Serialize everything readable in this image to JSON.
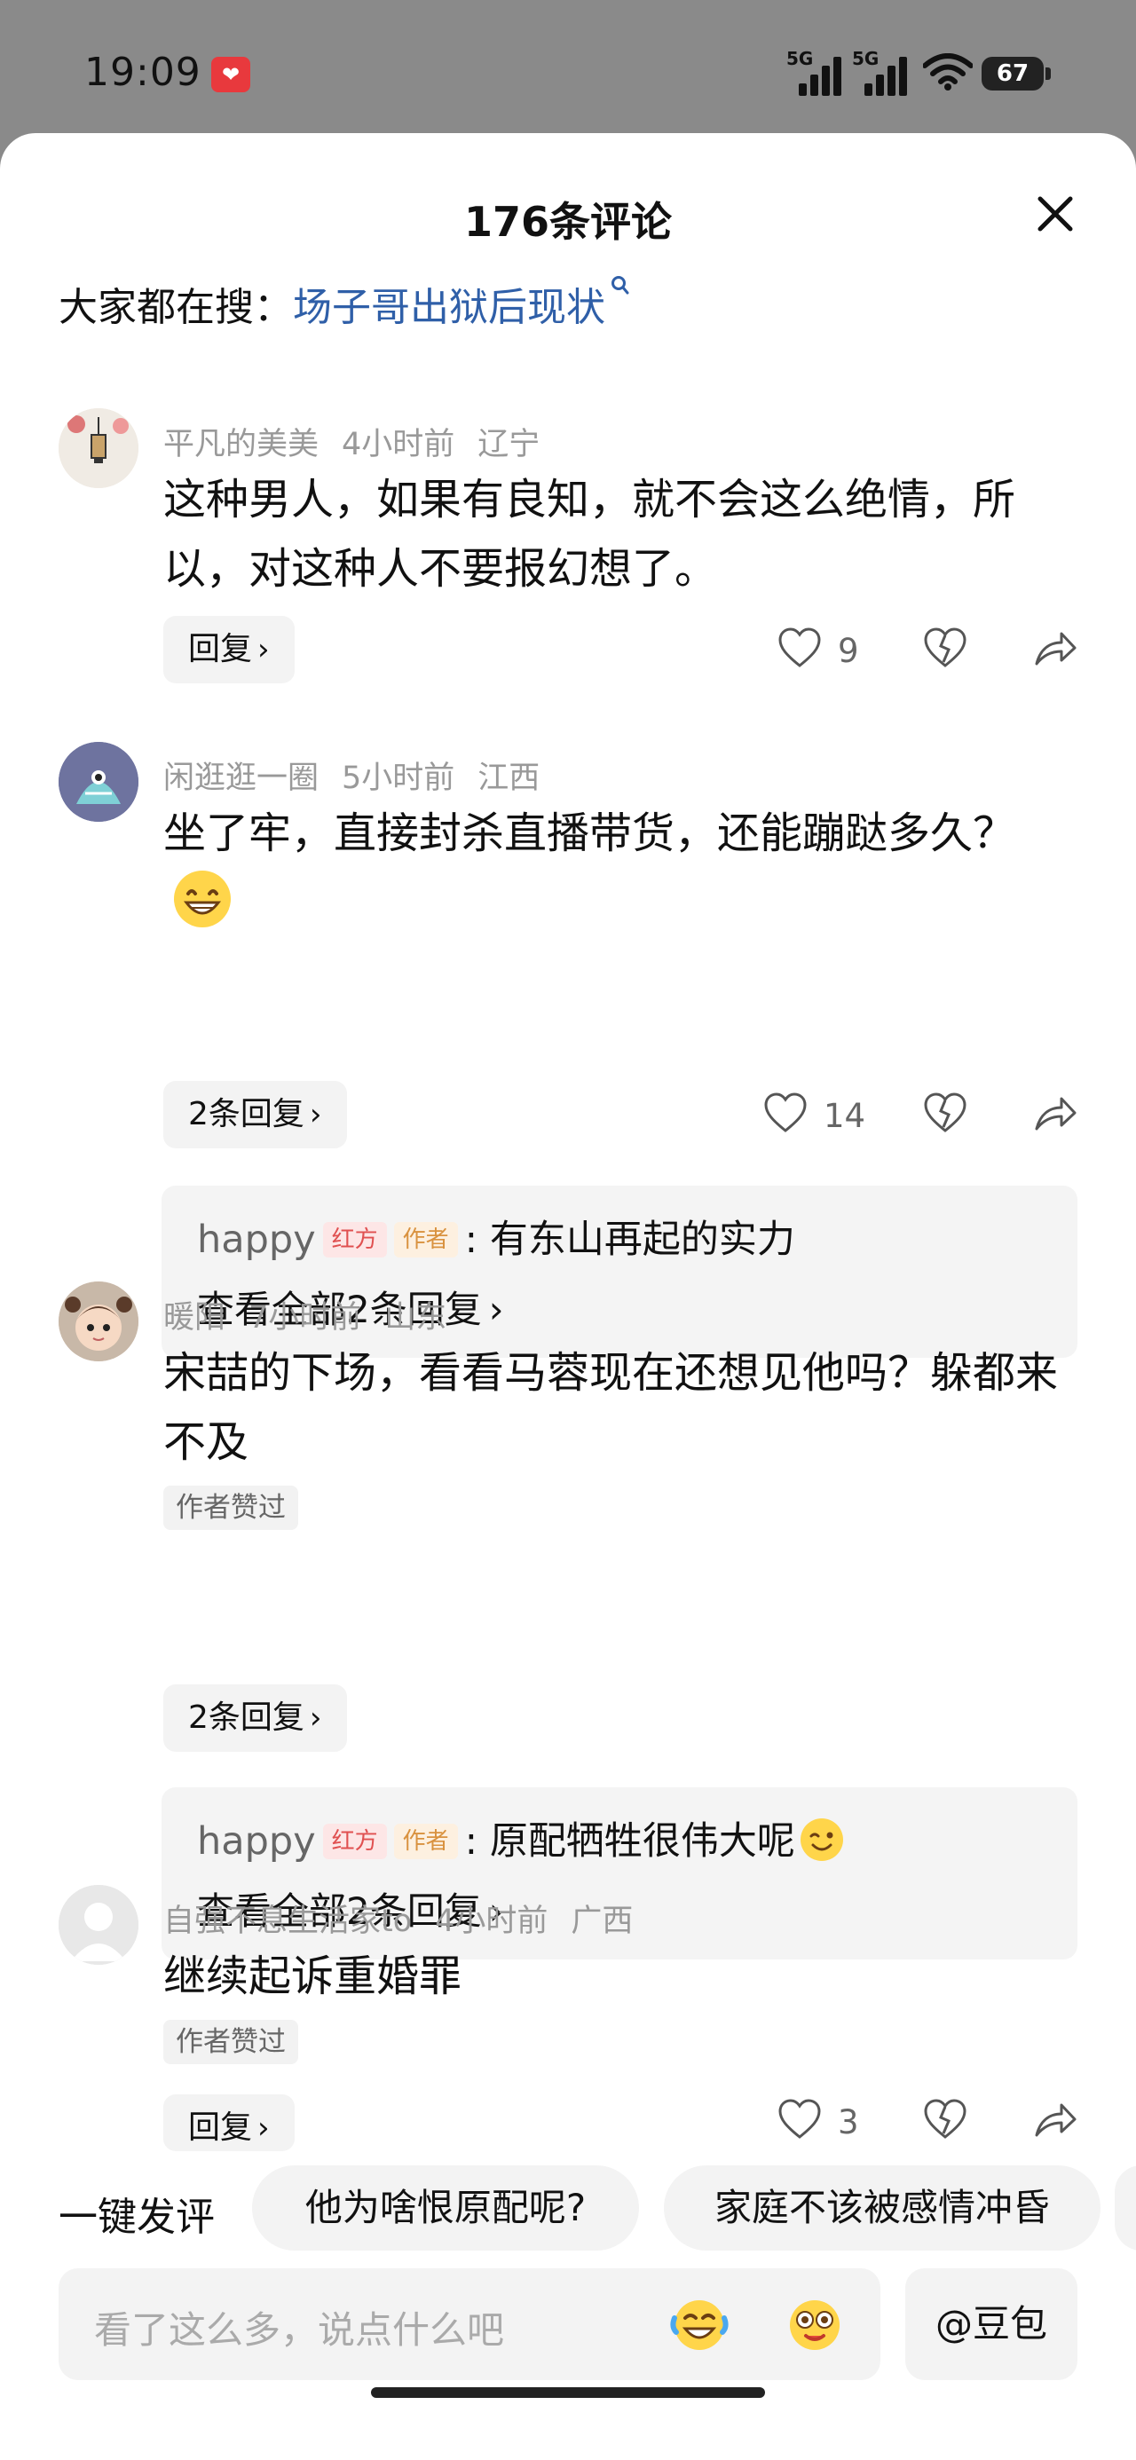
{
  "status_bar": {
    "time": "19:09",
    "signal1_label": "5G",
    "signal2_label": "5G",
    "battery": "67",
    "icons": [
      "app-notification-icon",
      "signal-icon",
      "signal-icon",
      "wifi-icon",
      "battery-icon"
    ]
  },
  "sheet": {
    "title": "176条评论",
    "search_prefix": "大家都在搜：",
    "search_link": "场子哥出狱后现状"
  },
  "comments": [
    {
      "user": "平凡的美美",
      "time": "4小时前",
      "region": "辽宁",
      "text": "这种男人，如果有良知，就不会这么绝情，所以，对这种人不要报幻想了。",
      "reply_btn": "回复",
      "likes": "9"
    },
    {
      "user": "闲逛逛一圈",
      "time": "5小时前",
      "region": "江西",
      "text": "坐了牢，直接封杀直播带货，还能蹦跶多久？",
      "reply_btn": "2条回复",
      "likes": "14",
      "sub_reply": {
        "user": "happy",
        "badge1": "红方",
        "badge2": "作者",
        "text": ": 有东山再起的实力",
        "more": "查看全部2条回复"
      }
    },
    {
      "user": "暖阳",
      "time": "7小时前",
      "region": "山东",
      "text": "宋喆的下场，看看马蓉现在还想见他吗？躲都来不及",
      "tag": "作者赞过",
      "reply_btn": "2条回复",
      "sub_reply": {
        "user": "happy",
        "badge1": "红方",
        "badge2": "作者",
        "text": ": 原配牺牲很伟大呢",
        "more": "查看全部2条回复"
      }
    },
    {
      "user": "自强不息生活家to",
      "time": "4小时前",
      "region": "广西",
      "text": "继续起诉重婚罪",
      "tag": "作者赞过",
      "reply_btn": "回复",
      "likes": "3"
    }
  ],
  "quick_comment": {
    "label": "一键发评",
    "chips": [
      "他为啥恨原配呢?",
      "家庭不该被感情冲昏"
    ]
  },
  "input": {
    "placeholder": "看了这么多，说点什么吧",
    "doubao": "@豆包"
  },
  "colors": {
    "link": "#2f5fa8",
    "badge_red": "#e05050",
    "badge_author": "#d9923f"
  }
}
